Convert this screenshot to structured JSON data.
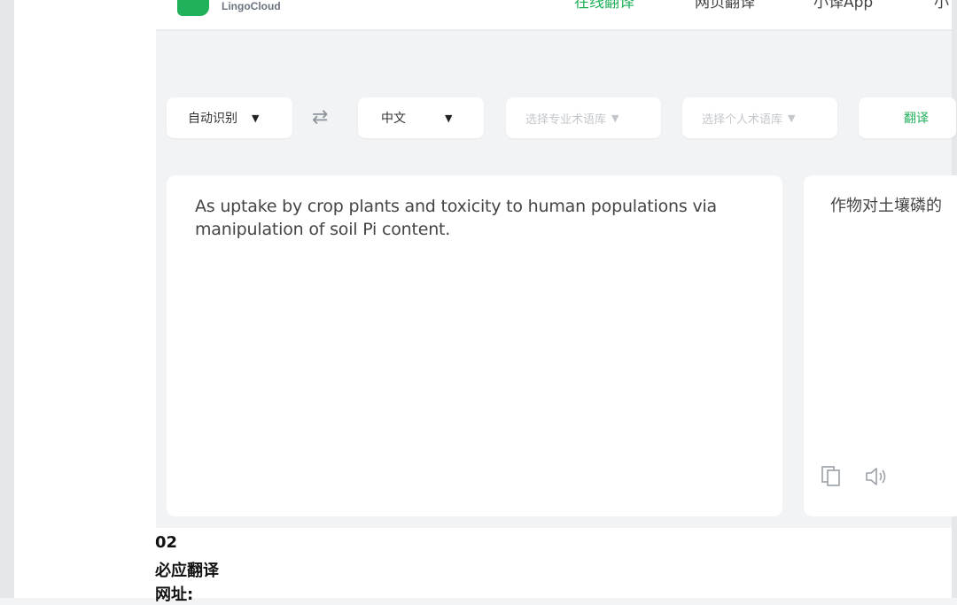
{
  "brand": {
    "name": "LingoCloud",
    "color": "#21b15a"
  },
  "nav": [
    {
      "label": "在线翻译",
      "active": true
    },
    {
      "label": "网页翻译",
      "active": false
    },
    {
      "label": "小译App",
      "active": false
    },
    {
      "label": "小",
      "active": false
    }
  ],
  "toolbar": {
    "source_lang": "自动识别",
    "target_lang": "中文",
    "term_pro": "选择专业术语库",
    "term_personal": "选择个人术语库",
    "translate_label": "翻译"
  },
  "input": {
    "text": "As uptake by crop plants and toxicity to human populations via manipulation of soil Pi content."
  },
  "output": {
    "text": "作物对土壤磷的"
  },
  "footer": {
    "number": "02",
    "title": "必应翻译",
    "url_label": "网址:"
  },
  "icons": [
    "logo-icon",
    "swap-icon",
    "caret-down-icon",
    "copy-icon",
    "speaker-icon"
  ]
}
